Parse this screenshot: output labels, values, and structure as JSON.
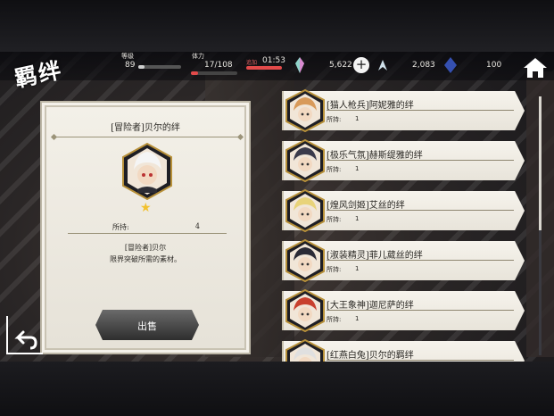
{
  "header": {
    "title": "羁绊",
    "level_label": "等级",
    "level_value": "89",
    "stamina_label": "体力",
    "stamina_value": "17/108",
    "timer_label": "追加",
    "timer_value": "01:53",
    "crystals": "5,622",
    "currency2": "2,083",
    "currency3": "100",
    "level_progress": 0.15,
    "stamina_progress": 0.16
  },
  "detail": {
    "title": "[冒险者]贝尔的绊",
    "stars": "★",
    "own_label": "所持:",
    "own_value": "4",
    "desc_line1": "[冒险者]贝尔",
    "desc_line2": "限界突破所需的素材。",
    "sell_label": "出售"
  },
  "list": [
    {
      "name": "[猫人枪兵]阿妮雅的绊",
      "own_label": "所持:",
      "own_value": "1",
      "color": "#d89a5a"
    },
    {
      "name": "[极乐气氛]赫斯缇雅的绊",
      "own_label": "所持:",
      "own_value": "1",
      "color": "#3a3a4a"
    },
    {
      "name": "[煌风剑姬]艾丝的绊",
      "own_label": "所持:",
      "own_value": "1",
      "color": "#e8d37a"
    },
    {
      "name": "[淑装精灵]菲儿葳丝的绊",
      "own_label": "所持:",
      "own_value": "1",
      "color": "#2a2a35"
    },
    {
      "name": "[大王象神]迦尼萨的绊",
      "own_label": "所持:",
      "own_value": "1",
      "color": "#c8402e"
    },
    {
      "name": "[红燕白兔]贝尔的羁绊",
      "own_label": "所持:",
      "own_value": "1",
      "color": "#e0e0e0"
    }
  ],
  "colors": {
    "accent": "#f2c12e",
    "panel": "#f3f0e8",
    "dark": "#1a1a1f"
  }
}
